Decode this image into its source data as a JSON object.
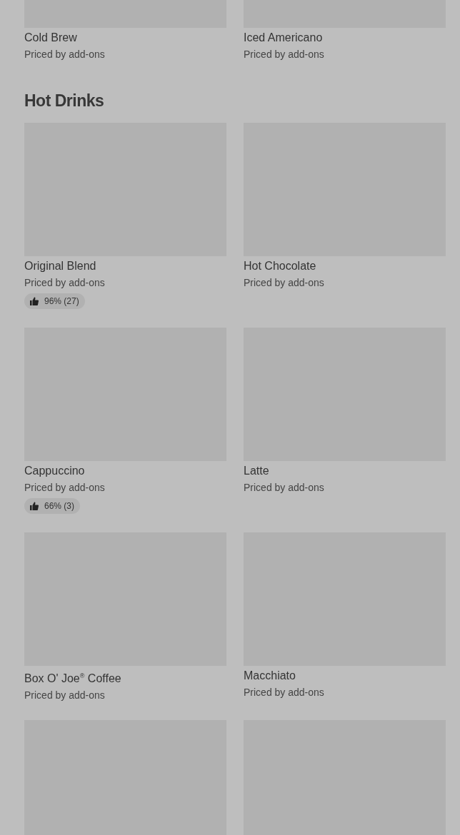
{
  "sections": [
    {
      "items": [
        {
          "kind": "cut_top",
          "name": "Cold Brew",
          "subtitle": "Priced by add-ons"
        },
        {
          "kind": "cut_top",
          "name": "Iced Americano",
          "subtitle": "Priced by add-ons"
        }
      ]
    },
    {
      "title": "Hot Drinks",
      "items": [
        {
          "kind": "card",
          "name": "Original Blend",
          "subtitle": "Priced by add-ons",
          "rating": "96% (27)"
        },
        {
          "kind": "card",
          "name": "Hot Chocolate",
          "subtitle": "Priced by add-ons"
        },
        {
          "kind": "card",
          "name": "Cappuccino",
          "subtitle": "Priced by add-ons",
          "rating": "66% (3)"
        },
        {
          "kind": "card",
          "name": "Latte",
          "subtitle": "Priced by add-ons"
        },
        {
          "kind": "card",
          "name": "Box O' Joe$^{®}$ Coffee",
          "subtitle": "Priced by add-ons"
        },
        {
          "kind": "card",
          "name": "Macchiato",
          "subtitle": "Priced by add-ons"
        },
        {
          "kind": "image_only"
        },
        {
          "kind": "image_only"
        }
      ]
    }
  ]
}
